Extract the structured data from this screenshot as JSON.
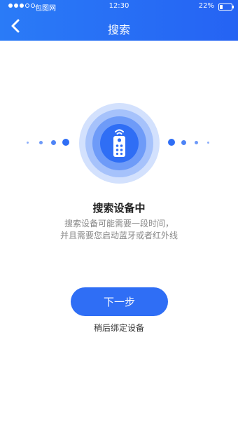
{
  "status_bar": {
    "carrier": "包图网",
    "time": "12:30",
    "battery": "22%",
    "battery_level": 0.22,
    "signal_bars_filled": 3,
    "signal_bars_total": 5
  },
  "header": {
    "title": "搜索",
    "back_icon": "chevron-left-icon"
  },
  "search_graphic": {
    "icon": "remote-control-icon",
    "colors": {
      "primary": "#2f6ef5",
      "ring_light": "#d3e1fd"
    }
  },
  "content": {
    "heading": "搜索设备中",
    "description_line1": "搜索设备可能需要一段时间，",
    "description_line2": "并且需要您启动蓝牙或者红外线"
  },
  "actions": {
    "next_label": "下一步",
    "later_label": "稍后绑定设备"
  }
}
